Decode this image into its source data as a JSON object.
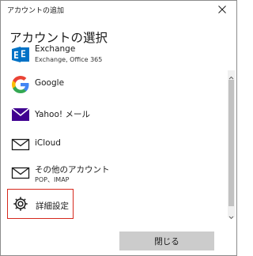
{
  "window": {
    "title": "アカウントの追加"
  },
  "heading": "アカウントの選択",
  "accounts": [
    {
      "name": "Exchange",
      "subtitle": "Exchange, Office 365",
      "icon": "exchange-icon"
    },
    {
      "name": "Google",
      "icon": "google-icon"
    },
    {
      "name": "Yahoo! メール",
      "icon": "yahoo-mail-icon"
    },
    {
      "name": "iCloud",
      "icon": "envelope-icon"
    },
    {
      "name": "その他のアカウント",
      "subtitle": "POP、IMAP",
      "icon": "envelope-icon"
    }
  ],
  "advanced": {
    "label": "詳細設定",
    "icon": "gear-icon"
  },
  "footer": {
    "close_label": "閉じる"
  },
  "colors": {
    "exchange_blue": "#0072c6",
    "yahoo_purple": "#400090",
    "highlight_border": "#d6281c",
    "button_bg": "#cccccc"
  }
}
